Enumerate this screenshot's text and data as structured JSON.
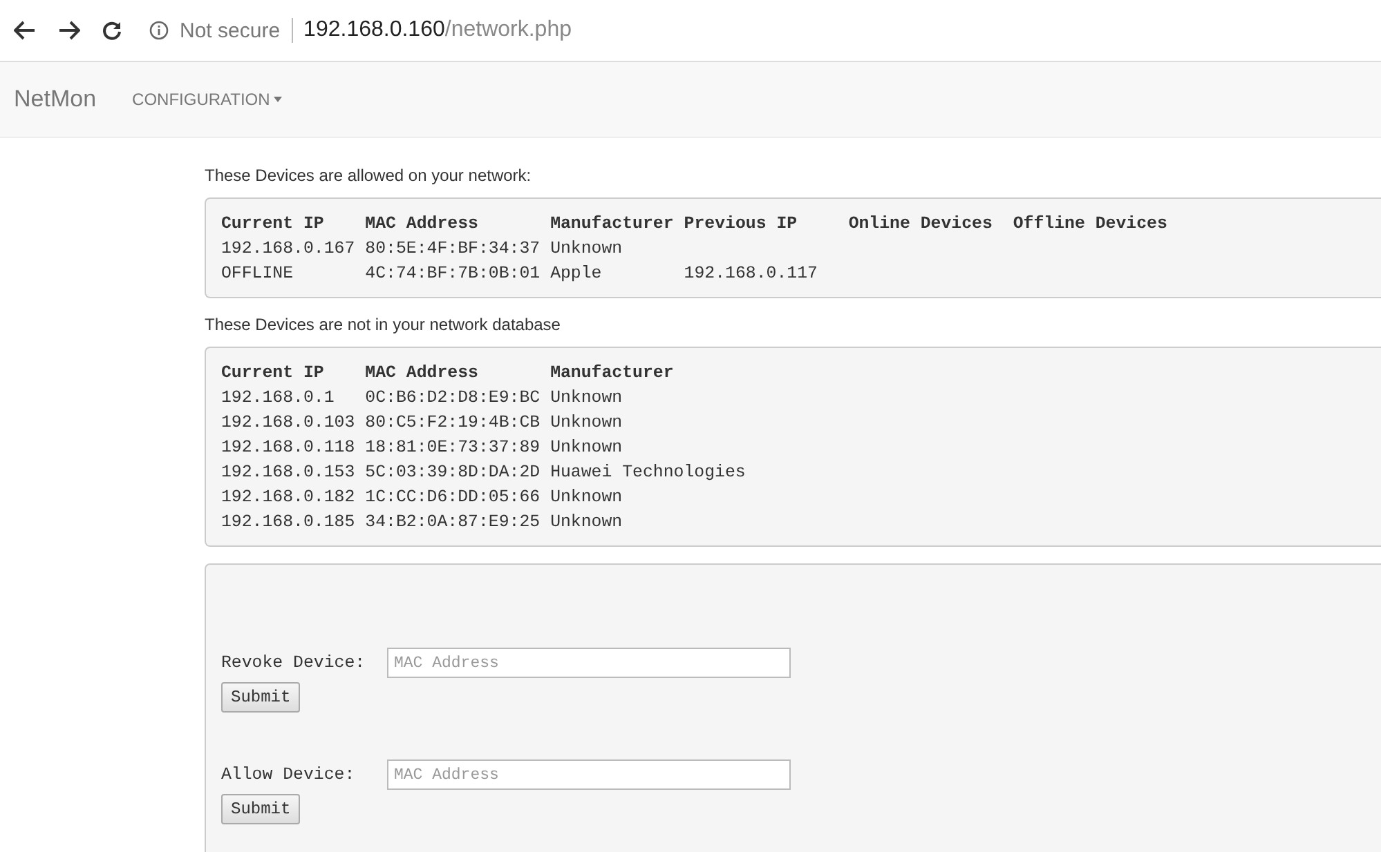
{
  "browser": {
    "security": "Not secure",
    "url_host": "192.168.0.160",
    "url_path": "/network.php"
  },
  "navbar": {
    "brand": "NetMon",
    "menu": "CONFIGURATION"
  },
  "allowed": {
    "caption": "These Devices are allowed on your network:",
    "columns": [
      "Current IP",
      "MAC Address",
      "Manufacturer",
      "Previous IP",
      "Online Devices",
      "Offline Devices"
    ],
    "rows": [
      [
        "192.168.0.167",
        "80:5E:4F:BF:34:37",
        "Unknown",
        "",
        "",
        ""
      ],
      [
        "OFFLINE",
        "4C:74:BF:7B:0B:01",
        "Apple",
        "192.168.0.117",
        "",
        ""
      ]
    ]
  },
  "unknown": {
    "caption": "These Devices are not in your network database",
    "columns": [
      "Current IP",
      "MAC Address",
      "Manufacturer"
    ],
    "rows": [
      [
        "192.168.0.1",
        "0C:B6:D2:D8:E9:BC",
        "Unknown"
      ],
      [
        "192.168.0.103",
        "80:C5:F2:19:4B:CB",
        "Unknown"
      ],
      [
        "192.168.0.118",
        "18:81:0E:73:37:89",
        "Unknown"
      ],
      [
        "192.168.0.153",
        "5C:03:39:8D:DA:2D",
        "Huawei Technologies"
      ],
      [
        "192.168.0.182",
        "1C:CC:D6:DD:05:66",
        "Unknown"
      ],
      [
        "192.168.0.185",
        "34:B2:0A:87:E9:25",
        "Unknown"
      ]
    ]
  },
  "forms": [
    {
      "label": "Revoke Device:",
      "placeholder": "MAC Address",
      "button": "Submit"
    },
    {
      "label": "Allow Device:",
      "placeholder": "MAC Address",
      "button": "Submit"
    }
  ]
}
